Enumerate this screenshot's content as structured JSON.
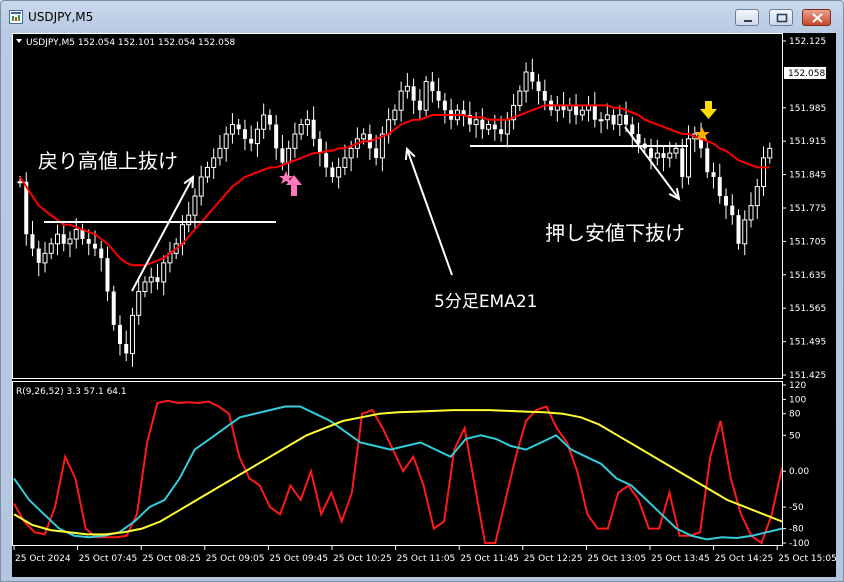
{
  "window": {
    "title": "USDJPY,M5",
    "buttons": [
      "minimize",
      "maximize",
      "close"
    ]
  },
  "colors": {
    "background": "#000000",
    "candle": "#ffffff",
    "ema": "#ff0000",
    "rsi_red": "#ff1a1a",
    "rsi_cyan": "#33ccdd",
    "rsi_yellow": "#ffff33",
    "hline": "#ffffff",
    "arrow_pink": "#ff77bb",
    "arrow_yellow": "#ffdd00",
    "star": "#ffaa00"
  },
  "chart_data": [
    {
      "type": "candlestick",
      "title": "USDJPY,M5",
      "ohlc_header": "USDJPY,M5  152.054 152.101 152.054 152.058",
      "current_price": "152.058",
      "ylim": [
        151.425,
        152.125
      ],
      "y_tick_labels": [
        "152.125",
        "151.985",
        "151.915",
        "151.845",
        "151.775",
        "151.705",
        "151.635",
        "151.565",
        "151.495",
        "151.425"
      ],
      "close": [
        151.83,
        151.72,
        151.69,
        151.66,
        151.68,
        151.7,
        151.72,
        151.7,
        151.71,
        151.73,
        151.71,
        151.7,
        151.69,
        151.67,
        151.6,
        151.53,
        151.49,
        151.47,
        151.55,
        151.6,
        151.62,
        151.63,
        151.62,
        151.66,
        151.68,
        151.7,
        151.74,
        151.76,
        151.8,
        151.84,
        151.86,
        151.88,
        151.9,
        151.93,
        151.95,
        151.94,
        151.92,
        151.91,
        151.94,
        151.97,
        151.95,
        151.9,
        151.87,
        151.9,
        151.93,
        151.95,
        151.96,
        151.92,
        151.89,
        151.86,
        151.84,
        151.86,
        151.88,
        151.9,
        151.92,
        151.93,
        151.9,
        151.88,
        151.93,
        151.96,
        151.98,
        152.02,
        152.03,
        152.0,
        151.98,
        152.04,
        152.02,
        152.0,
        151.98,
        151.96,
        151.98,
        151.97,
        151.95,
        151.96,
        151.94,
        151.95,
        151.94,
        151.93,
        151.96,
        151.99,
        152.02,
        152.06,
        152.04,
        152.02,
        152.0,
        151.98,
        151.99,
        151.98,
        151.99,
        151.97,
        151.98,
        151.99,
        151.96,
        151.96,
        151.97,
        151.95,
        151.97,
        151.95,
        151.93,
        151.91,
        151.9,
        151.88,
        151.89,
        151.88,
        151.89,
        151.9,
        151.84,
        151.92,
        151.93,
        151.9,
        151.85,
        151.84,
        151.8,
        151.78,
        151.76,
        151.7,
        151.75,
        151.78,
        151.82,
        151.88,
        151.9
      ]
    },
    {
      "type": "line",
      "name": "EMA21",
      "values": [
        151.84,
        151.82,
        151.8,
        151.78,
        151.77,
        151.76,
        151.75,
        151.74,
        151.74,
        151.735,
        151.73,
        151.725,
        151.72,
        151.71,
        151.7,
        151.685,
        151.67,
        151.66,
        151.655,
        151.655,
        151.655,
        151.66,
        151.665,
        151.67,
        151.68,
        151.69,
        151.7,
        151.715,
        151.73,
        151.745,
        151.76,
        151.775,
        151.79,
        151.805,
        151.82,
        151.83,
        151.84,
        151.845,
        151.85,
        151.855,
        151.86,
        151.86,
        151.865,
        151.87,
        151.875,
        151.88,
        151.885,
        151.89,
        151.89,
        151.895,
        151.895,
        151.9,
        151.9,
        151.905,
        151.91,
        151.915,
        151.915,
        151.92,
        151.925,
        151.93,
        151.94,
        151.95,
        151.955,
        151.96,
        151.96,
        151.965,
        151.97,
        151.97,
        151.97,
        151.97,
        151.97,
        151.97,
        151.965,
        151.965,
        151.965,
        151.96,
        151.96,
        151.96,
        151.96,
        151.965,
        151.97,
        151.975,
        151.98,
        151.985,
        151.99,
        151.99,
        151.99,
        151.99,
        151.99,
        151.99,
        151.99,
        151.99,
        151.99,
        151.99,
        151.99,
        151.985,
        151.985,
        151.98,
        151.975,
        151.97,
        151.96,
        151.955,
        151.95,
        151.945,
        151.94,
        151.935,
        151.93,
        151.93,
        151.925,
        151.92,
        151.915,
        151.91,
        151.9,
        151.895,
        151.885,
        151.875,
        151.87,
        151.865,
        151.86,
        151.86,
        151.86
      ]
    },
    {
      "type": "line",
      "title": "R(9,26,52) 3.3 57.1 64.1",
      "ylim": [
        -100,
        120
      ],
      "y_tick_labels": [
        "120",
        "100",
        "80",
        "50",
        "0.00",
        "-50",
        "-80",
        "-100"
      ],
      "x_tick_labels": [
        "25 Oct 2024",
        "25 Oct 07:45",
        "25 Oct 08:25",
        "25 Oct 09:05",
        "25 Oct 09:45",
        "25 Oct 10:25",
        "25 Oct 11:05",
        "25 Oct 11:45",
        "25 Oct 12:25",
        "25 Oct 13:05",
        "25 Oct 13:45",
        "25 Oct 14:25",
        "25 Oct 15:05"
      ],
      "series": [
        {
          "values": [
            -45,
            -70,
            -85,
            -88,
            -50,
            20,
            -10,
            -80,
            -92,
            -92,
            -92,
            -90,
            -60,
            40,
            95,
            98,
            95,
            96,
            95,
            97,
            90,
            80,
            20,
            -10,
            -20,
            -50,
            -60,
            -20,
            -40,
            0,
            -60,
            -30,
            -70,
            -30,
            80,
            85,
            60,
            30,
            0,
            20,
            -20,
            -80,
            -70,
            30,
            60,
            -20,
            -100,
            -100,
            -40,
            20,
            70,
            85,
            90,
            60,
            40,
            0,
            -60,
            -80,
            -80,
            -30,
            -20,
            -40,
            -80,
            -80,
            -30,
            -90,
            -90,
            -85,
            20,
            70,
            -10,
            -60,
            -90,
            -100,
            -60,
            5
          ]
        },
        {
          "values": [
            -10,
            -40,
            -60,
            -80,
            -90,
            -92,
            -90,
            -85,
            -70,
            -50,
            -40,
            -10,
            30,
            45,
            60,
            75,
            80,
            85,
            90,
            90,
            80,
            70,
            55,
            40,
            35,
            30,
            35,
            40,
            30,
            20,
            45,
            50,
            45,
            35,
            30,
            40,
            50,
            30,
            20,
            10,
            -10,
            -20,
            -40,
            -60,
            -80,
            -90,
            -95,
            -92,
            -93,
            -90,
            -85,
            -80
          ]
        },
        {
          "values": [
            -60,
            -75,
            -82,
            -85,
            -88,
            -88,
            -85,
            -80,
            -70,
            -55,
            -40,
            -25,
            -10,
            5,
            20,
            35,
            50,
            60,
            70,
            75,
            80,
            82,
            83,
            84,
            85,
            85,
            85,
            84,
            83,
            82,
            80,
            75,
            65,
            50,
            35,
            20,
            5,
            -10,
            -25,
            -40,
            -50,
            -60,
            -70
          ]
        }
      ]
    }
  ],
  "annotations": {
    "label_1": "戻り高値上抜け",
    "label_2": "5分足EMA21",
    "label_3": "押し安値下抜け"
  }
}
